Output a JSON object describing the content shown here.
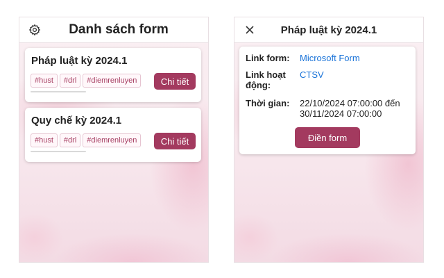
{
  "list_panel": {
    "title": "Danh sách form",
    "settings_icon": "gear-icon",
    "forms": [
      {
        "title": "Pháp luật kỳ 2024.1",
        "tags": [
          "#hust",
          "#drl",
          "#diemrenluyen"
        ],
        "button": "Chi tiết"
      },
      {
        "title": "Quy chế kỳ 2024.1",
        "tags": [
          "#hust",
          "#drl",
          "#diemrenluyen"
        ],
        "button": "Chi tiết"
      }
    ]
  },
  "detail_panel": {
    "title": "Pháp luật kỳ 2024.1",
    "close_icon": "close-icon",
    "link_form_label": "Link form:",
    "link_form_value": "Microsoft Form",
    "link_activity_label_1": "Link hoạt",
    "link_activity_label_2": "động:",
    "link_activity_value": "CTSV",
    "time_label": "Thời gian:",
    "time_line_1": "22/10/2024 07:00:00 đến",
    "time_line_2": "30/11/2024 07:00:00",
    "fill_button": "Điền form"
  },
  "colors": {
    "accent": "#a33a5f",
    "link": "#1a73d8",
    "tag_text": "#a73f63"
  }
}
